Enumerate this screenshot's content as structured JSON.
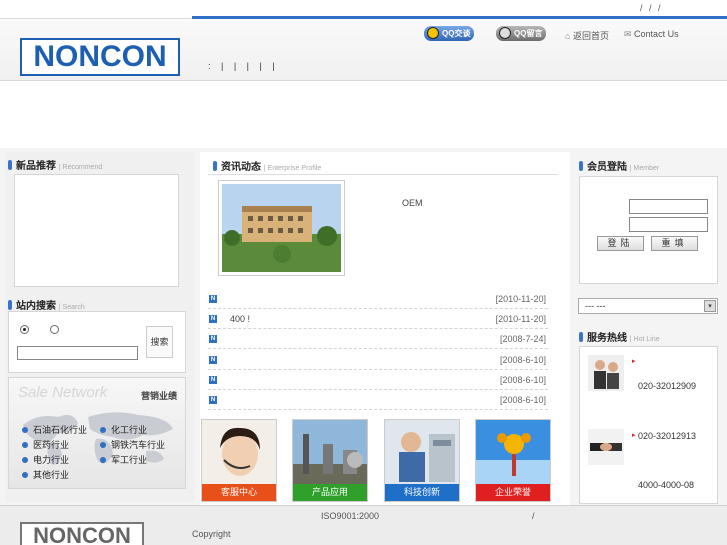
{
  "top": {
    "links": "/ / /"
  },
  "brand": {
    "logo": "NONCON"
  },
  "header": {
    "qq_buttons": [
      "QQ交谈",
      "QQ留言"
    ],
    "home_link": "返回首页",
    "contact_link": "Contact Us",
    "nav": ":  |  |  |  |  |"
  },
  "left": {
    "new_products": {
      "title": "新品推荐",
      "sub": "Recommend"
    },
    "search": {
      "title": "站内搜索",
      "sub": "Search",
      "button": "搜索",
      "input_value": ""
    },
    "sales": {
      "watermark": "Sale Network",
      "title": "营销业绩",
      "industries": [
        "石油石化行业",
        "化工行业",
        "医药行业",
        "钢铁汽车行业",
        "电力行业",
        "军工行业",
        "其他行业"
      ]
    }
  },
  "center": {
    "news": {
      "title": "资讯动态",
      "sub": "Enterprise Profile",
      "oem_text": "OEM"
    },
    "items": [
      {
        "title": "",
        "date": "[2010-11-20]"
      },
      {
        "title": "400    !",
        "date": "[2010-11-20]"
      },
      {
        "title": "",
        "date": "[2008-7-24]"
      },
      {
        "title": "",
        "date": "[2008-6-10]"
      },
      {
        "title": "",
        "date": "[2008-6-10]"
      },
      {
        "title": "",
        "date": "[2008-6-10]"
      }
    ],
    "tiles": [
      {
        "label": "客服中心",
        "color": "#e8501a"
      },
      {
        "label": "产品应用",
        "color": "#2fa12b"
      },
      {
        "label": "科技创新",
        "color": "#1e6fc8"
      },
      {
        "label": "企业荣誉",
        "color": "#e02020"
      }
    ]
  },
  "right": {
    "login": {
      "title": "会员登陆",
      "sub": "Member",
      "login_btn": "登陆",
      "reset_btn": "重填"
    },
    "select": {
      "value": "---    ---"
    },
    "hotline": {
      "title": "服务热线",
      "sub": "Hot Line",
      "phones": [
        "020-32012909",
        "020-32012913",
        "4000-4000-08"
      ]
    }
  },
  "footer": {
    "logo": "NONCON",
    "iso": "ISO9001:2000",
    "slash": "/",
    "copyright": "Copyright"
  }
}
